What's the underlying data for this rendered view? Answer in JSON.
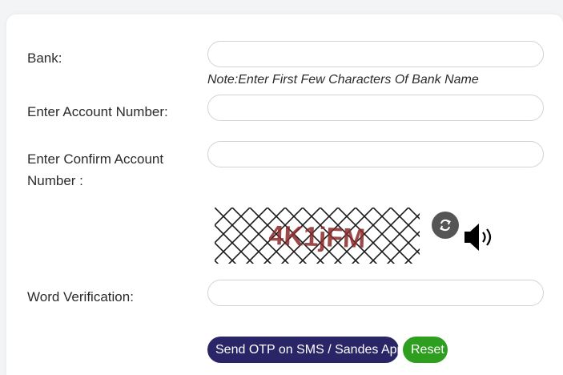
{
  "form": {
    "bank_label": "Bank:",
    "bank_value": "",
    "bank_note": "Note:Enter First Few Characters Of Bank Name",
    "account_label": "Enter Account Number:",
    "account_value": "",
    "confirm_label_line1": "Enter Confirm Account",
    "confirm_label_line2": "Number :",
    "confirm_value": "",
    "captcha_text": "4K1jFM",
    "word_label": "Word Verification:",
    "word_value": "",
    "send_otp_label": "Send OTP on SMS / Sandes App",
    "reset_label": "Reset"
  },
  "icons": {
    "refresh": "refresh-icon",
    "audio": "speaker-icon"
  },
  "colors": {
    "otp_button": "#2a2566",
    "reset_button": "#2e9e1e",
    "captcha_text": "#8b2a2a"
  }
}
